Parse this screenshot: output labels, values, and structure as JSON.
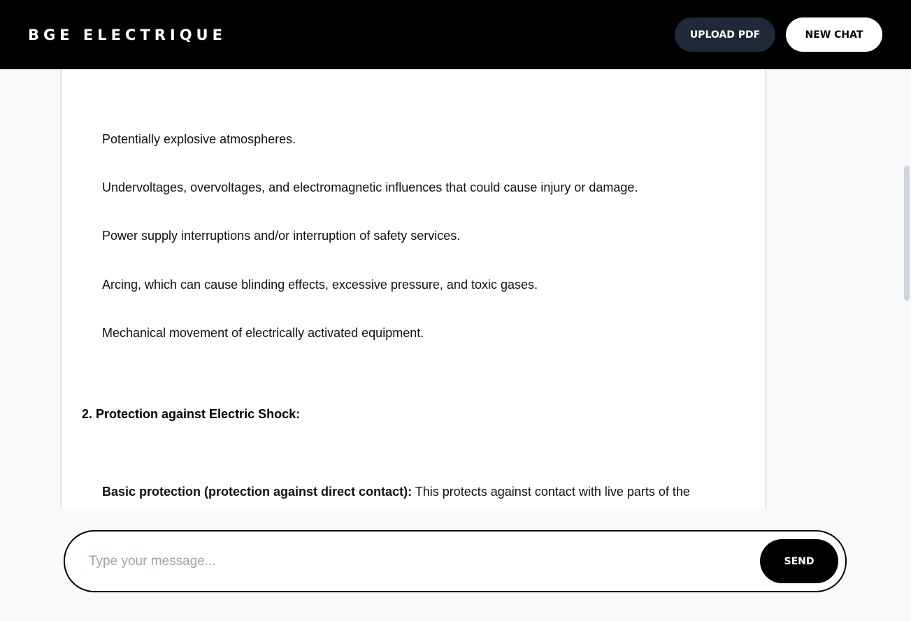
{
  "header": {
    "brand": "BGE ELECTRIQUE",
    "upload_label": "UPLOAD PDF",
    "new_chat_label": "NEW CHAT"
  },
  "message": {
    "hazards": [
      "Potentially explosive atmospheres.",
      "Undervoltages, overvoltages, and electromagnetic influences that could cause injury or damage.",
      "Power supply interruptions and/or interruption of safety services.",
      "Arcing, which can cause blinding effects, excessive pressure, and toxic gases.",
      "Mechanical movement of electrically activated equipment."
    ],
    "section_heading": "2. Protection against Electric Shock:",
    "basic_protection_label": "Basic protection (protection against direct contact):",
    "basic_protection_text": " This protects against contact with live parts of the"
  },
  "composer": {
    "placeholder": "Type your message...",
    "value": "",
    "send_label": "SEND"
  },
  "colors": {
    "header_bg": "#000000",
    "upload_button_bg": "#1f2937",
    "page_bg": "#f8f9fb"
  }
}
